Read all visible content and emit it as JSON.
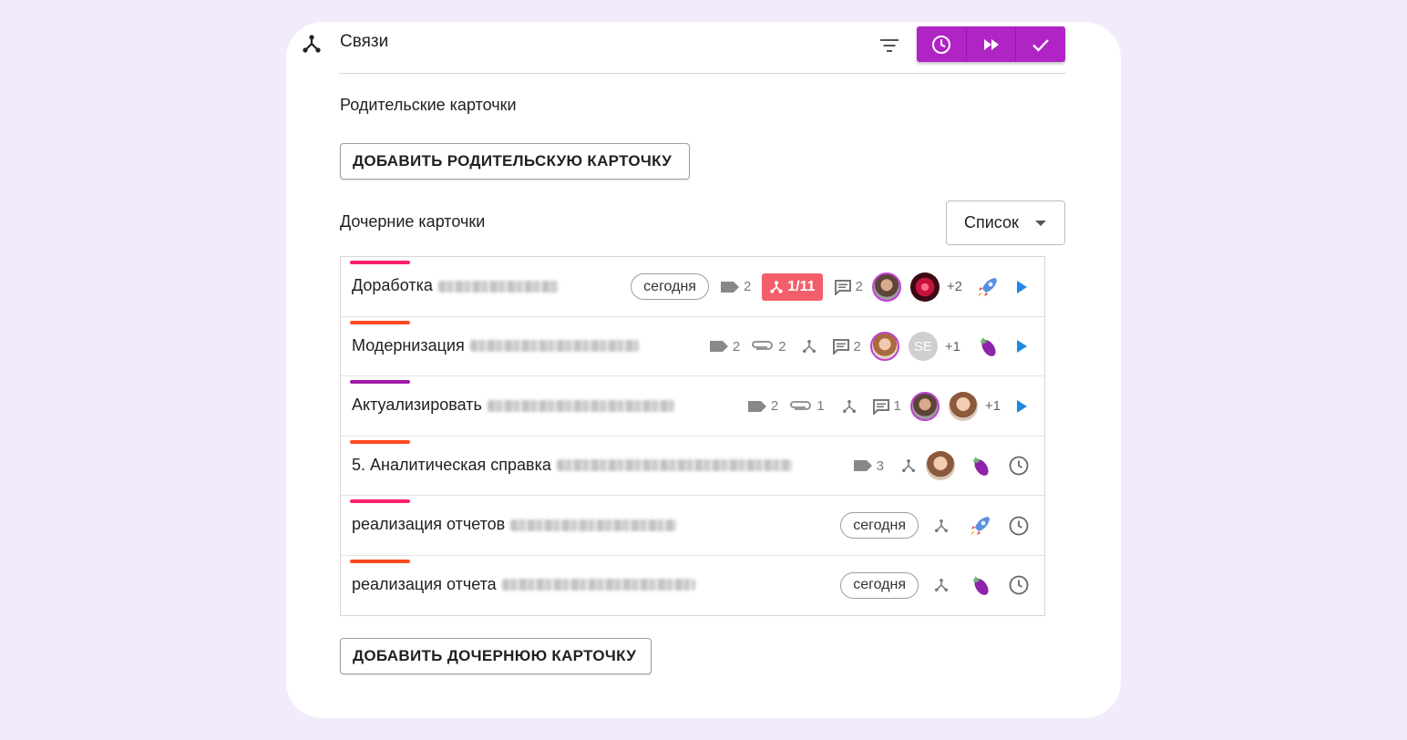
{
  "header": {
    "title": "Связи"
  },
  "parents": {
    "title": "Родительские карточки",
    "add_button": "ДОБАВИТЬ РОДИТЕЛЬСКУЮ КАРТОЧКУ"
  },
  "children": {
    "title": "Дочерние карточки",
    "view": "Список",
    "add_button": "ДОБАВИТЬ ДОЧЕРНЮЮ КАРТОЧКУ",
    "rows": [
      {
        "title": "Доработка",
        "stripe": "#ff1f6e",
        "chip": "сегодня",
        "tags": "2",
        "relations": "1/11",
        "comments": "2",
        "more": "+2",
        "icon": "rocket-icon",
        "status": "play-icon"
      },
      {
        "title": "Модернизация",
        "stripe": "#ff4a1f",
        "tags": "2",
        "files": "2",
        "comments": "2",
        "avatar_initials": "SE",
        "more": "+1",
        "icon": "eggplant-icon",
        "status": "play-icon"
      },
      {
        "title": "Актуализировать",
        "stripe": "#a51aa8",
        "tags": "2",
        "files": "1",
        "comments": "1",
        "more": "+1",
        "status": "play-icon"
      },
      {
        "title": "5. Аналитическая справка",
        "stripe": "#ff4a1f",
        "tags": "3",
        "icon": "eggplant-icon",
        "status": "clock-icon"
      },
      {
        "title": "реализация отчетов",
        "stripe": "#ff1f6e",
        "chip": "сегодня",
        "icon": "rocket-icon",
        "status": "clock-icon"
      },
      {
        "title": "реализация отчета",
        "stripe": "#ff4a1f",
        "chip": "сегодня",
        "icon": "eggplant-icon",
        "status": "clock-icon"
      }
    ]
  },
  "colors": {
    "accent": "#b024c5",
    "play": "#1e88e5",
    "badge": "#f25f6a"
  }
}
